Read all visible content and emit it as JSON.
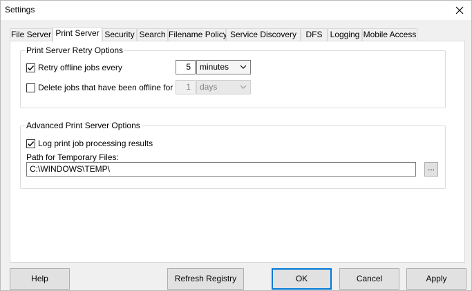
{
  "window": {
    "title": "Settings"
  },
  "tabs": [
    {
      "label": "File Server",
      "active": false
    },
    {
      "label": "Print Server",
      "active": true
    },
    {
      "label": "Security",
      "active": false
    },
    {
      "label": "Search",
      "active": false
    },
    {
      "label": "Filename Policy",
      "active": false
    },
    {
      "label": "Service Discovery",
      "active": false
    },
    {
      "label": "DFS",
      "active": false
    },
    {
      "label": "Logging",
      "active": false
    },
    {
      "label": "Mobile Access",
      "active": false
    }
  ],
  "retry_group": {
    "title": "Print Server Retry Options",
    "retry_offline": {
      "label": "Retry offline jobs every",
      "checked": true,
      "value": "5",
      "unit": "minutes"
    },
    "delete_jobs": {
      "label": "Delete jobs that have been offline for",
      "checked": false,
      "value": "1",
      "unit": "days"
    }
  },
  "advanced_group": {
    "title": "Advanced Print Server Options",
    "log_results": {
      "label": "Log print job processing results",
      "checked": true
    },
    "temp_path_label": "Path for Temporary Files:",
    "temp_path_value": "C:\\WINDOWS\\TEMP\\",
    "browse_label": "..."
  },
  "buttons": {
    "help": "Help",
    "refresh": "Refresh Registry",
    "ok": "OK",
    "cancel": "Cancel",
    "apply": "Apply"
  },
  "colors": {
    "accent": "#0078d7",
    "panel_bg": "#ffffff",
    "window_bg": "#f0f0f0"
  }
}
